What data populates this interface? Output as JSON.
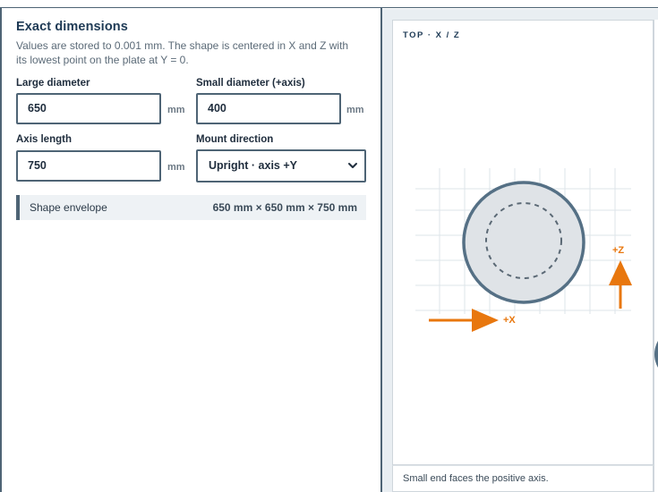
{
  "panel": {
    "title": "Exact dimensions",
    "description": "Values are stored to 0.001 mm. The shape is centered in X and Z with its lowest point on the plate at Y = 0."
  },
  "fields": {
    "large_diameter": {
      "label": "Large diameter",
      "value": "650",
      "unit": "mm"
    },
    "small_diameter": {
      "label": "Small diameter (+axis)",
      "value": "400",
      "unit": "mm"
    },
    "axis_length": {
      "label": "Axis length",
      "value": "750",
      "unit": "mm"
    },
    "mount_direction": {
      "label": "Mount direction",
      "value": "Upright · axis +Y"
    }
  },
  "envelope": {
    "label": "Shape envelope",
    "value": "650 mm × 650 mm × 750 mm"
  },
  "viewer": {
    "heading": "TOP · X / Z",
    "x_axis_label": "+X",
    "z_axis_label": "+Z",
    "footer": "Small end faces the positive axis.",
    "accent_color": "#e8770e",
    "outline_color": "#557085"
  },
  "icons": {
    "select": "chevron-down-icon"
  }
}
